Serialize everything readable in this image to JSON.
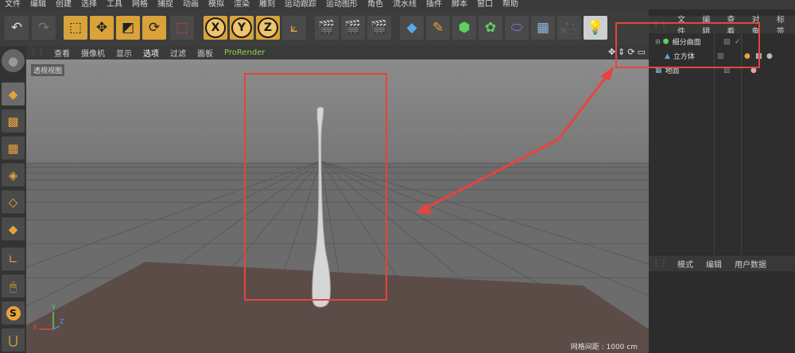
{
  "menubar": [
    "文件",
    "编辑",
    "创建",
    "选择",
    "工具",
    "网格",
    "捕捉",
    "动画",
    "模拟",
    "渲染",
    "雕刻",
    "运动跟踪",
    "运动图形",
    "角色",
    "流水线",
    "插件",
    "脚本",
    "窗口",
    "帮助"
  ],
  "viewport_menu": [
    "查看",
    "摄像机",
    "显示",
    "选项",
    "过滤",
    "面板",
    "ProRender"
  ],
  "viewport_label": "透视视图",
  "grid_info": "网格间距 : 1000 cm",
  "axis_labels": {
    "x": "X",
    "y": "Y",
    "z": "Z"
  },
  "object_manager_menu": [
    "文件",
    "编辑",
    "查看",
    "对象",
    "标签"
  ],
  "objects": [
    {
      "name": "细分曲面"
    },
    {
      "name": "立方体"
    },
    {
      "name": "地面"
    }
  ],
  "attributes_menu": [
    "模式",
    "编辑",
    "用户数据"
  ],
  "toolbar": {
    "undo": "undo-icon",
    "redo": "redo-icon",
    "select": "select-icon",
    "move": "move-icon",
    "scale": "scale-icon",
    "rotate": "rotate-icon",
    "xyz": [
      "X",
      "Y",
      "Z"
    ]
  },
  "colors": {
    "highlight": "#d9a33a",
    "annotation": "#e8433f",
    "prorender": "#8fd14f"
  }
}
